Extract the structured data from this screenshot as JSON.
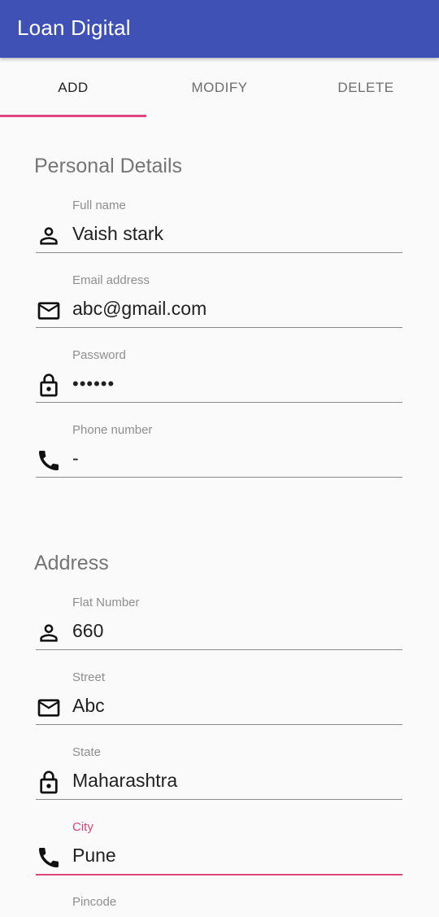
{
  "appbar": {
    "title": "Loan Digital",
    "color": "#3f51b5"
  },
  "tabs": [
    {
      "label": "ADD",
      "active": true
    },
    {
      "label": "MODIFY",
      "active": false
    },
    {
      "label": "DELETE",
      "active": false
    }
  ],
  "accent_color": "#e0457b",
  "personal": {
    "title": "Personal Details",
    "fields": [
      {
        "label": "Full name",
        "value": "Vaish stark",
        "icon": "person-icon"
      },
      {
        "label": "Email address",
        "value": "abc@gmail.com",
        "icon": "mail-icon"
      },
      {
        "label": "Password",
        "value": "••••••",
        "icon": "lock-icon"
      },
      {
        "label": "Phone number",
        "value": "-",
        "icon": "phone-icon"
      }
    ]
  },
  "address": {
    "title": "Address",
    "fields": [
      {
        "label": "Flat Number",
        "value": "660",
        "icon": "person-icon"
      },
      {
        "label": "Street",
        "value": "Abc",
        "icon": "mail-icon"
      },
      {
        "label": "State",
        "value": "Maharashtra",
        "icon": "lock-icon"
      },
      {
        "label": "City",
        "value": "Pune",
        "icon": "phone-icon",
        "focused": true
      },
      {
        "label": "Pincode",
        "value": "",
        "icon": "person-icon"
      }
    ]
  }
}
